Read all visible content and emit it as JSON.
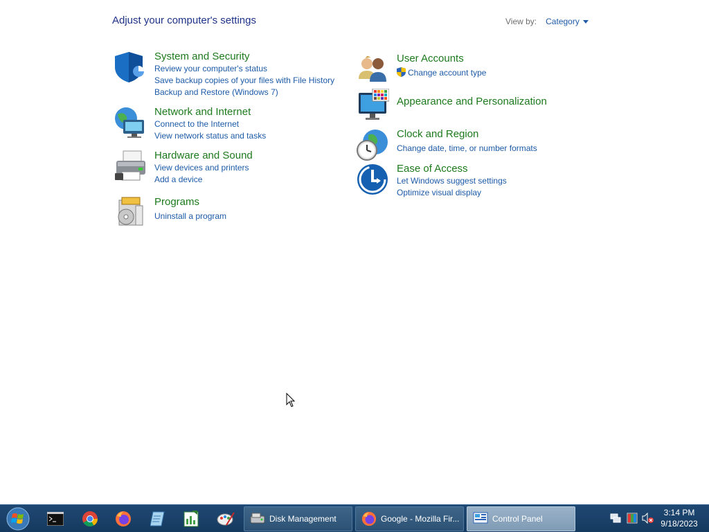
{
  "header": {
    "title": "Adjust your computer's settings",
    "view_by_label": "View by:",
    "view_by_value": "Category"
  },
  "categories": {
    "system_security": {
      "title": "System and Security",
      "links": [
        "Review your computer's status",
        "Save backup copies of your files with File History",
        "Backup and Restore (Windows 7)"
      ]
    },
    "network": {
      "title": "Network and Internet",
      "links": [
        "Connect to the Internet",
        "View network status and tasks"
      ]
    },
    "hardware": {
      "title": "Hardware and Sound",
      "links": [
        "View devices and printers",
        "Add a device"
      ]
    },
    "programs": {
      "title": "Programs",
      "links": [
        "Uninstall a program"
      ]
    },
    "user_accounts": {
      "title": "User Accounts",
      "links": [
        "Change account type"
      ]
    },
    "appearance": {
      "title": "Appearance and Personalization",
      "links": []
    },
    "clock": {
      "title": "Clock and Region",
      "links": [
        "Change date, time, or number formats"
      ]
    },
    "ease": {
      "title": "Ease of Access",
      "links": [
        "Let Windows suggest settings",
        "Optimize visual display"
      ]
    }
  },
  "taskbar": {
    "pinned": [
      "terminal-icon",
      "chrome-icon",
      "firefox-icon",
      "notepad-icon",
      "spreadsheet-icon",
      "paint-icon"
    ],
    "buttons": [
      {
        "label": "Disk Management",
        "icon": "disk-management-icon",
        "active": false
      },
      {
        "label": "Google - Mozilla Fir...",
        "icon": "firefox-icon",
        "active": false
      },
      {
        "label": "Control Panel",
        "icon": "control-panel-icon",
        "active": true
      }
    ],
    "tray_icons": [
      "network-icon",
      "color-icon",
      "volume-muted-icon"
    ],
    "time": "3:14 PM",
    "date": "9/18/2023"
  },
  "colors": {
    "title_green": "#1d7a1d",
    "link_blue": "#1c5aa8",
    "heading_blue": "#1e3287",
    "taskbar": "#1e4873"
  }
}
